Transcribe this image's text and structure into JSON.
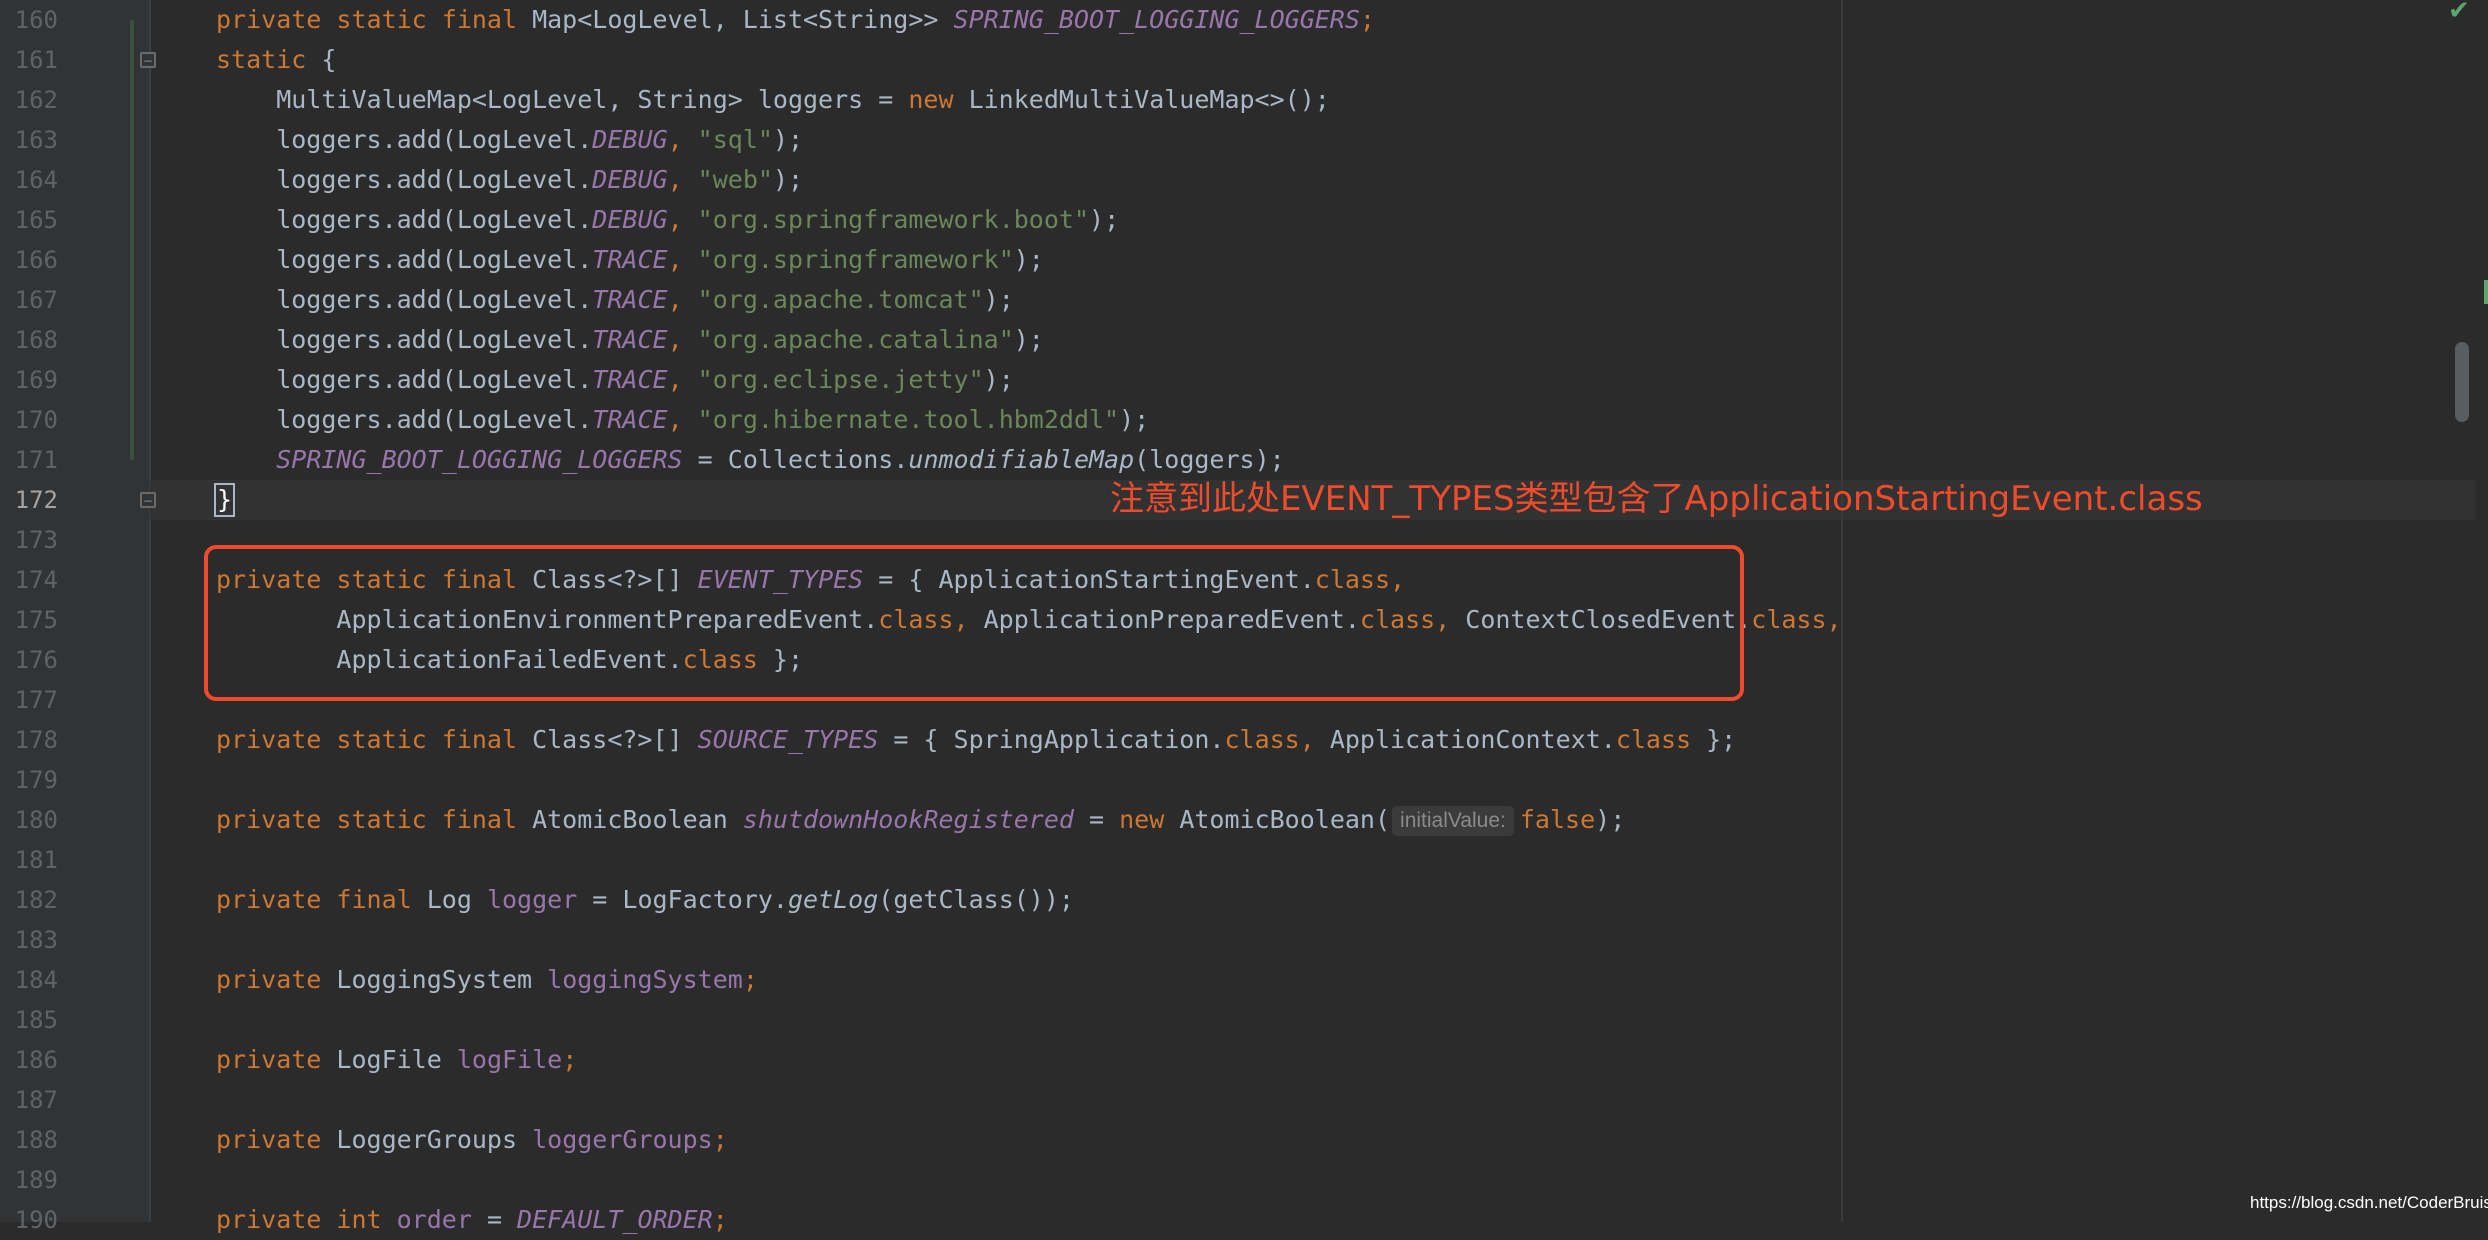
{
  "editor": {
    "lines": [
      {
        "num": "160",
        "code": [
          [
            "kw",
            "private static final "
          ],
          [
            "",
            "Map<LogLevel, List<String>> "
          ],
          [
            "st",
            "SPRING_BOOT_LOGGING_LOGGERS"
          ],
          [
            "kw",
            ";"
          ]
        ]
      },
      {
        "num": "161",
        "code": [
          [
            "kw",
            "static "
          ],
          [
            "",
            "{"
          ]
        ]
      },
      {
        "num": "162",
        "code": [
          [
            "",
            "    MultiValueMap<LogLevel, String> loggers = "
          ],
          [
            "kw",
            "new "
          ],
          [
            "",
            "LinkedMultiValueMap<>();"
          ]
        ]
      },
      {
        "num": "163",
        "code": [
          [
            "",
            "    loggers.add(LogLevel."
          ],
          [
            "st",
            "DEBUG"
          ],
          [
            "kw",
            ", "
          ],
          [
            "str",
            "\"sql\""
          ],
          [
            "",
            "); "
          ]
        ]
      },
      {
        "num": "164",
        "code": [
          [
            "",
            "    loggers.add(LogLevel."
          ],
          [
            "st",
            "DEBUG"
          ],
          [
            "kw",
            ", "
          ],
          [
            "str",
            "\"web\""
          ],
          [
            "",
            ");"
          ]
        ]
      },
      {
        "num": "165",
        "code": [
          [
            "",
            "    loggers.add(LogLevel."
          ],
          [
            "st",
            "DEBUG"
          ],
          [
            "kw",
            ", "
          ],
          [
            "str",
            "\"org.springframework.boot\""
          ],
          [
            "",
            ");"
          ]
        ]
      },
      {
        "num": "166",
        "code": [
          [
            "",
            "    loggers.add(LogLevel."
          ],
          [
            "st",
            "TRACE"
          ],
          [
            "kw",
            ", "
          ],
          [
            "str",
            "\"org.springframework\""
          ],
          [
            "",
            ");"
          ]
        ]
      },
      {
        "num": "167",
        "code": [
          [
            "",
            "    loggers.add(LogLevel."
          ],
          [
            "st",
            "TRACE"
          ],
          [
            "kw",
            ", "
          ],
          [
            "str",
            "\"org.apache.tomcat\""
          ],
          [
            "",
            ");"
          ]
        ]
      },
      {
        "num": "168",
        "code": [
          [
            "",
            "    loggers.add(LogLevel."
          ],
          [
            "st",
            "TRACE"
          ],
          [
            "kw",
            ", "
          ],
          [
            "str",
            "\"org.apache.catalina\""
          ],
          [
            "",
            ");"
          ]
        ]
      },
      {
        "num": "169",
        "code": [
          [
            "",
            "    loggers.add(LogLevel."
          ],
          [
            "st",
            "TRACE"
          ],
          [
            "kw",
            ", "
          ],
          [
            "str",
            "\"org.eclipse.jetty\""
          ],
          [
            "",
            ");"
          ]
        ]
      },
      {
        "num": "170",
        "code": [
          [
            "",
            "    loggers.add(LogLevel."
          ],
          [
            "st",
            "TRACE"
          ],
          [
            "kw",
            ", "
          ],
          [
            "str",
            "\"org.hibernate.tool.hbm2ddl\""
          ],
          [
            "",
            ");"
          ]
        ]
      },
      {
        "num": "171",
        "code": [
          [
            "",
            "    "
          ],
          [
            "st",
            "SPRING_BOOT_LOGGING_LOGGERS"
          ],
          [
            "",
            " = Collections."
          ],
          [
            "it",
            "unmodifiableMap"
          ],
          [
            "",
            "(loggers);"
          ]
        ]
      },
      {
        "num": "172",
        "code": [
          [
            "caret",
            "}"
          ]
        ]
      },
      {
        "num": "173",
        "code": []
      },
      {
        "num": "174",
        "code": [
          [
            "kw",
            "private static final "
          ],
          [
            "",
            "Class<?>[] "
          ],
          [
            "st",
            "EVENT_TYPES"
          ],
          [
            "",
            " = { ApplicationStartingEvent."
          ],
          [
            "kw",
            "class,"
          ]
        ]
      },
      {
        "num": "175",
        "code": [
          [
            "",
            "        ApplicationEnvironmentPreparedEvent."
          ],
          [
            "kw",
            "class, "
          ],
          [
            "",
            "ApplicationPreparedEvent."
          ],
          [
            "kw",
            "class, "
          ],
          [
            "",
            "ContextClosedEvent."
          ],
          [
            "kw",
            "class,"
          ]
        ]
      },
      {
        "num": "176",
        "code": [
          [
            "",
            "        ApplicationFailedEvent."
          ],
          [
            "kw",
            "class "
          ],
          [
            "",
            "};"
          ]
        ]
      },
      {
        "num": "177",
        "code": []
      },
      {
        "num": "178",
        "code": [
          [
            "kw",
            "private static final "
          ],
          [
            "",
            "Class<?>[] "
          ],
          [
            "st",
            "SOURCE_TYPES"
          ],
          [
            "",
            " = { SpringApplication."
          ],
          [
            "kw",
            "class, "
          ],
          [
            "",
            "ApplicationContext."
          ],
          [
            "kw",
            "class "
          ],
          [
            "",
            "};"
          ]
        ]
      },
      {
        "num": "179",
        "code": []
      },
      {
        "num": "180",
        "code": [
          [
            "kw",
            "private static final "
          ],
          [
            "",
            "AtomicBoolean "
          ],
          [
            "st",
            "shutdownHookRegistered"
          ],
          [
            "",
            " = "
          ],
          [
            "kw",
            "new "
          ],
          [
            "",
            "AtomicBoolean("
          ],
          [
            "hint",
            "initialValue:"
          ],
          [
            "kw",
            "false"
          ],
          [
            "",
            ");"
          ]
        ]
      },
      {
        "num": "181",
        "code": []
      },
      {
        "num": "182",
        "code": [
          [
            "kw",
            "private final "
          ],
          [
            "",
            "Log "
          ],
          [
            "fld",
            "logger"
          ],
          [
            "",
            " = LogFactory."
          ],
          [
            "it",
            "getLog"
          ],
          [
            "",
            "(getClass());"
          ]
        ]
      },
      {
        "num": "183",
        "code": []
      },
      {
        "num": "184",
        "code": [
          [
            "kw",
            "private "
          ],
          [
            "",
            "LoggingSystem "
          ],
          [
            "fld",
            "loggingSystem"
          ],
          [
            "kw",
            ";"
          ]
        ]
      },
      {
        "num": "185",
        "code": []
      },
      {
        "num": "186",
        "code": [
          [
            "kw",
            "private "
          ],
          [
            "",
            "LogFile "
          ],
          [
            "fld",
            "logFile"
          ],
          [
            "kw",
            ";"
          ]
        ]
      },
      {
        "num": "187",
        "code": []
      },
      {
        "num": "188",
        "code": [
          [
            "kw",
            "private "
          ],
          [
            "",
            "LoggerGroups "
          ],
          [
            "fld",
            "loggerGroups"
          ],
          [
            "kw",
            ";"
          ]
        ]
      },
      {
        "num": "189",
        "code": []
      },
      {
        "num": "190",
        "code": [
          [
            "kw",
            "private int "
          ],
          [
            "fld",
            "order"
          ],
          [
            "",
            " = "
          ],
          [
            "st",
            "DEFAULT_ORDER"
          ],
          [
            "kw",
            ";"
          ]
        ]
      }
    ],
    "current_line": "172"
  },
  "annotation": "注意到此处EVENT_TYPES类型包含了ApplicationStartingEvent.class",
  "watermark": "https://blog.csdn.net/CoderBruis",
  "colors": {
    "background": "#2b2b2b",
    "gutter": "#313335",
    "keyword": "#cc7832",
    "static_field": "#9876aa",
    "string": "#6a8759",
    "default_text": "#a9b7c6",
    "annotation_red": "#ee4c2c"
  },
  "icons": {
    "inspection_ok": "checkmark-icon",
    "fold_start": "fold-collapse-icon",
    "fold_end": "fold-end-icon"
  }
}
